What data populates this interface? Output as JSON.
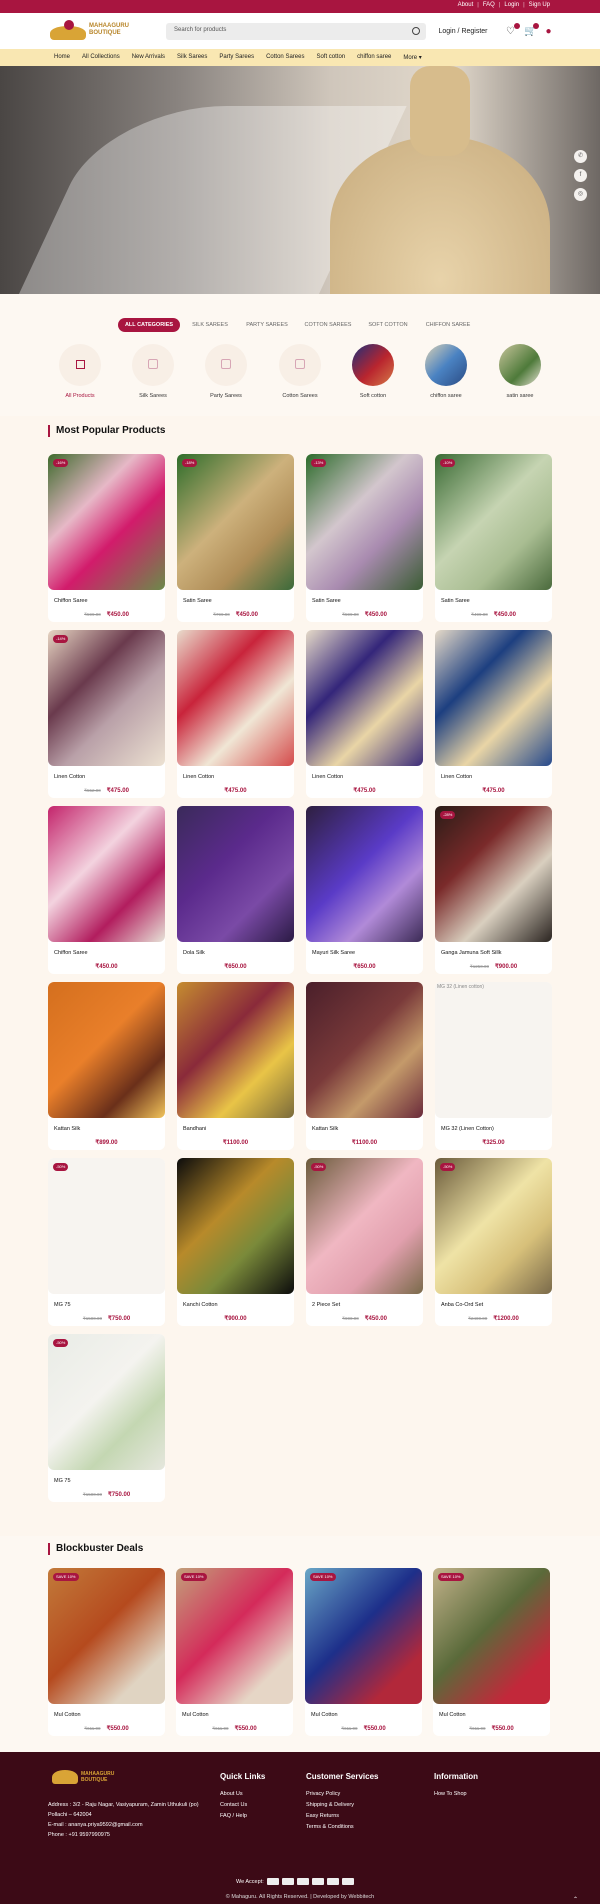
{
  "topbar": {
    "links": [
      "About",
      "FAQ",
      "Login",
      "Sign Up"
    ]
  },
  "header": {
    "brand_line1": "MAHAAGURU",
    "brand_line2": "BOUTIQUE",
    "search_placeholder": "Search for products",
    "login_label": "Login / Register",
    "icons": [
      "heart-icon",
      "cart-icon",
      "user-icon"
    ]
  },
  "nav": {
    "items": [
      "Home",
      "All Collections",
      "New Arrivals",
      "Silk Sarees",
      "Party Sarees",
      "Cotton Sarees",
      "Soft cotton",
      "chiffon saree",
      "More ▾"
    ]
  },
  "hero": {
    "social": [
      "whatsapp-icon",
      "facebook-icon",
      "instagram-icon"
    ]
  },
  "category_tabs": [
    "ALL CATEGORIES",
    "SILK SAREES",
    "PARTY SAREES",
    "COTTON SAREES",
    "SOFT COTTON",
    "CHIFFON SAREE"
  ],
  "categories": [
    "All Products",
    "Silk Sarees",
    "Party Sarees",
    "Cotton Sarees",
    "Soft cotton",
    "chiffon saree",
    "satin saree"
  ],
  "popular": {
    "title": "Most Popular Products",
    "products": [
      {
        "name": "Chiffon Saree",
        "old": "₹599.00",
        "price": "₹450.00",
        "disc": "-16%"
      },
      {
        "name": "Satin Saree",
        "old": "₹799.00",
        "price": "₹450.00",
        "disc": "-18%"
      },
      {
        "name": "Satin Saree",
        "old": "₹599.00",
        "price": "₹450.00",
        "disc": "-13%"
      },
      {
        "name": "Satin Saree",
        "old": "₹499.00",
        "price": "₹450.00",
        "disc": "-10%"
      },
      {
        "name": "Linen Cotton",
        "old": "₹552.00",
        "price": "₹475.00",
        "disc": "-14%"
      },
      {
        "name": "Linen Cotton",
        "old": "",
        "price": "₹475.00",
        "disc": ""
      },
      {
        "name": "Linen Cotton",
        "old": "",
        "price": "₹475.00",
        "disc": ""
      },
      {
        "name": "Linen Cotton",
        "old": "",
        "price": "₹475.00",
        "disc": ""
      },
      {
        "name": "Chiffon Saree",
        "old": "",
        "price": "₹450.00",
        "disc": ""
      },
      {
        "name": "Dola Silk",
        "old": "",
        "price": "₹650.00",
        "disc": ""
      },
      {
        "name": "Mayuri Silk Saree",
        "old": "",
        "price": "₹650.00",
        "disc": ""
      },
      {
        "name": "Ganga Jamuna Soft Sillk",
        "old": "₹1250.00",
        "price": "₹900.00",
        "disc": "-28%"
      },
      {
        "name": "Kattan Silk",
        "old": "",
        "price": "₹899.00",
        "disc": ""
      },
      {
        "name": "Bandhani",
        "old": "",
        "price": "₹1100.00",
        "disc": ""
      },
      {
        "name": "Kattan Silk",
        "old": "",
        "price": "₹1100.00",
        "disc": ""
      },
      {
        "name": "MG 32 (Linen Cotton)",
        "old": "",
        "price": "₹325.00",
        "disc": "",
        "broken": "MG 32 (Linen cotton)"
      },
      {
        "name": "MG 75",
        "old": "₹1500.00",
        "price": "₹750.00",
        "disc": "-50%"
      },
      {
        "name": "Kanchi Cotton",
        "old": "",
        "price": "₹900.00",
        "disc": ""
      },
      {
        "name": "2 Piece Set",
        "old": "₹900.00",
        "price": "₹450.00",
        "disc": "-50%"
      },
      {
        "name": "Anba Co-Ord Set",
        "old": "₹2400.00",
        "price": "₹1200.00",
        "disc": "-50%"
      },
      {
        "name": "MG 75",
        "old": "₹1500.00",
        "price": "₹750.00",
        "disc": "-50%"
      }
    ]
  },
  "deals": {
    "title": "Blockbuster Deals",
    "products": [
      {
        "name": "Mul Cotton",
        "old": "₹611.00",
        "price": "₹550.00",
        "disc": "SAVE 10%"
      },
      {
        "name": "Mul Cotton",
        "old": "₹611.00",
        "price": "₹550.00",
        "disc": "SAVE 10%"
      },
      {
        "name": "Mul Cotton",
        "old": "₹611.00",
        "price": "₹550.00",
        "disc": "SAVE 10%"
      },
      {
        "name": "Mul Cotton",
        "old": "₹611.00",
        "price": "₹550.00",
        "disc": "SAVE 10%"
      }
    ]
  },
  "footer": {
    "brand_line1": "MAHAAGURU",
    "brand_line2": "BOUTIQUE",
    "address": "Address : 3/2 - Raju Nagar, Vasiyapuram, Zamin Uthukuli (po) Pollachi – 642004",
    "email": "E-mail : ananya.priya9592@gmail.com",
    "phone": "Phone : +91 9597990975",
    "quick_title": "Quick Links",
    "quick_links": [
      "About Us",
      "Contact Us",
      "FAQ / Help"
    ],
    "service_title": "Customer Services",
    "service_links": [
      "Privacy Policy",
      "Shipping & Delivery",
      "Easy Returns",
      "Terms & Conditions"
    ],
    "info_title": "Information",
    "info_links": [
      "How To Shop"
    ],
    "accept_label": "We Accept:",
    "copyright": "© Mahaguru. All Rights Reserved. | Developed by Webbitech"
  }
}
